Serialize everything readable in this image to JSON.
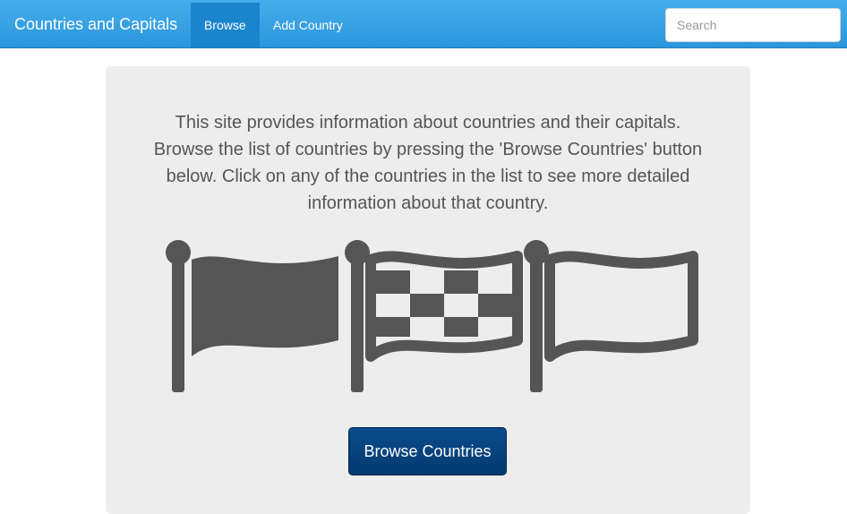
{
  "navbar": {
    "brand": "Countries and Capitals",
    "links": [
      {
        "label": "Browse",
        "active": true
      },
      {
        "label": "Add Country",
        "active": false
      }
    ],
    "search_placeholder": "Search",
    "background_color": "#2b96dc",
    "active_link_color": "#1a85cd"
  },
  "main": {
    "intro_text": "This site provides information about countries and their capitals. Browse the list of countries by pressing the 'Browse Countries' button below. Click on any of the countries in the list to see more detailed information about that country.",
    "illustration_icons": [
      "flag-solid-icon",
      "flag-checkered-icon",
      "flag-outline-icon"
    ],
    "browse_button_label": "Browse Countries",
    "button_color": "#033a70",
    "panel_color": "#ededed"
  }
}
